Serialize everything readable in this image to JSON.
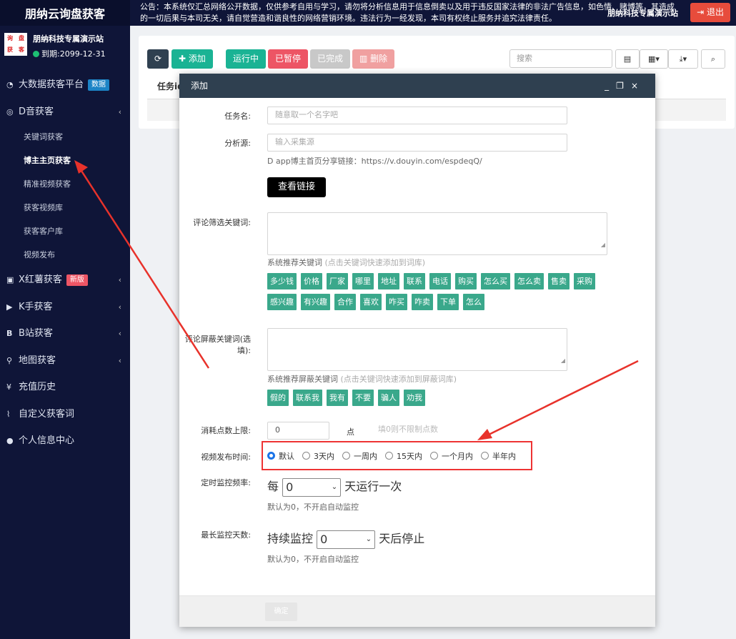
{
  "brand": "朋纳云询盘获客",
  "user": {
    "logo_chars": [
      "询",
      "盘",
      "获",
      "客"
    ],
    "name": "朋纳科技专属演示站",
    "expire": "到期:2099-12-31"
  },
  "menu": [
    {
      "icon": "dashboard-icon",
      "label": "大数据获客平台",
      "badge": "数据",
      "badge_color": "#1c84c6"
    },
    {
      "icon": "douyin-icon",
      "label": "D音获客",
      "chevron": "‹"
    },
    {
      "label": "关键词获客"
    },
    {
      "label": "博主主页获客"
    },
    {
      "label": "精准视频获客"
    },
    {
      "label": "获客视频库"
    },
    {
      "label": "获客客户库"
    },
    {
      "label": "视频发布"
    },
    {
      "icon": "xiaohongshu-icon",
      "label": "X红薯获客",
      "badge": "新版",
      "badge_color": "#ed5565",
      "chevron": "‹"
    },
    {
      "icon": "kuaishou-icon",
      "label": "K手获客",
      "chevron": "‹"
    },
    {
      "icon": "bilibili-icon",
      "label": "B站获客",
      "chevron": "‹"
    },
    {
      "icon": "map-marker-icon",
      "label": "地图获客",
      "chevron": "‹"
    },
    {
      "icon": "yen-icon",
      "label": "充值历史"
    },
    {
      "icon": "rss-icon",
      "label": "自定义获客词"
    },
    {
      "icon": "user-icon",
      "label": "个人信息中心"
    }
  ],
  "topbar": {
    "notice": "公告：本系统仅汇总网络公开数据，仅供参考自用与学习，请勿将分析信息用于信息倒卖以及用于违反国家法律的非法广告信息，如色情、赌博等，其造成的一切后果与本司无关，请自觉营造和谐良性的网络营销环境。违法行为一经发现，本司有权终止服务并追究法律责任。",
    "site": "朋纳科技专属演示站",
    "logout": "退出"
  },
  "toolbar": {
    "add": "添加",
    "running": "运行中",
    "paused": "已暂停",
    "done": "已完成",
    "delete": "删除",
    "search_placeholder": "搜索"
  },
  "table": {
    "first_header": "任务id"
  },
  "modal": {
    "title": "添加",
    "task_name_label": "任务名:",
    "task_name_placeholder": "随意取一个名字吧",
    "source_label": "分析源:",
    "source_placeholder": "输入采集源",
    "source_help": "D app博主首页分享链接：https://v.douyin.com/espdeqQ/",
    "view_link": "查看链接",
    "comment_kw_label": "评论筛选关键词:",
    "sys_kw": "系统推荐关键词",
    "sys_kw_hint": "(点击关键词快速添加到词库)",
    "keywords": [
      "多少钱",
      "价格",
      "厂家",
      "哪里",
      "地址",
      "联系",
      "电话",
      "购买",
      "怎么买",
      "怎么卖",
      "售卖",
      "采购",
      "感兴趣",
      "有兴趣",
      "合作",
      "喜欢",
      "咋买",
      "咋卖",
      "下单",
      "怎么"
    ],
    "block_kw_label": "评论屏蔽关键词(选填):",
    "sys_block": "系统推荐屏蔽关键词",
    "sys_block_hint": "(点击关键词快速添加到屏蔽词库)",
    "block_keywords": [
      "假的",
      "联系我",
      "我有",
      "不要",
      "骗人",
      "劝我"
    ],
    "points_label": "消耗点数上限:",
    "points_value": "0",
    "points_unit": "点",
    "points_hint": "填0则不限制点数",
    "publish_label": "视频发布时间:",
    "publish_options": [
      "默认",
      "3天内",
      "一周内",
      "15天内",
      "一个月内",
      "半年内"
    ],
    "freq_label": "定时监控频率:",
    "freq_prefix": "每",
    "freq_value": "0",
    "freq_suffix": "天运行一次",
    "freq_help": "默认为0，不开启自动监控",
    "days_label": "最长监控天数:",
    "days_prefix": "持续监控",
    "days_value": "0",
    "days_suffix": "天后停止",
    "days_help": "默认为0，不开启自动监控",
    "ok": "确定"
  }
}
